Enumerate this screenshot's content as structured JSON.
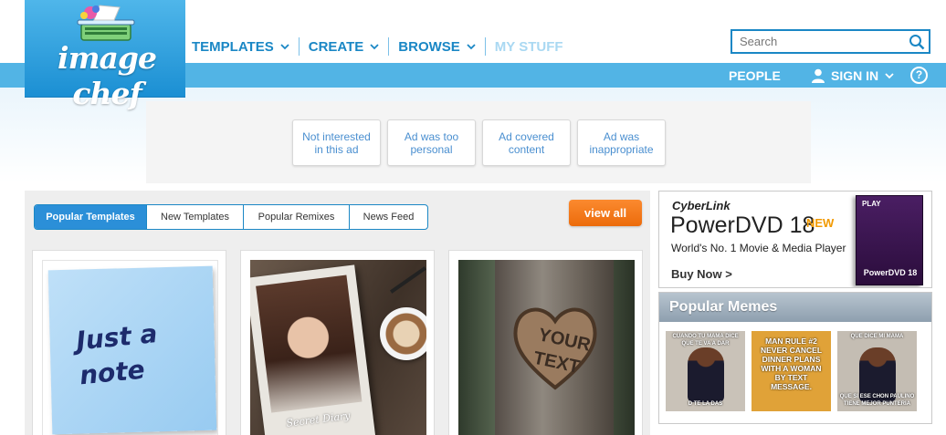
{
  "header": {
    "logo_text": "image chef",
    "nav": [
      {
        "label": "TEMPLATES",
        "has_menu": true
      },
      {
        "label": "CREATE",
        "has_menu": true
      },
      {
        "label": "BROWSE",
        "has_menu": true
      },
      {
        "label": "MY STUFF",
        "has_menu": false,
        "muted": true
      }
    ],
    "search_placeholder": "Search",
    "people_label": "PEOPLE",
    "signin_label": "SIGN IN",
    "help_label": "?"
  },
  "ad_feedback": {
    "buttons": [
      "Not interested in this ad",
      "Ad was too personal",
      "Ad covered content",
      "Ad was inappropriate"
    ]
  },
  "main": {
    "tabs": [
      {
        "label": "Popular Templates",
        "active": true
      },
      {
        "label": "New Templates",
        "active": false
      },
      {
        "label": "Popular Remixes",
        "active": false
      },
      {
        "label": "News Feed",
        "active": false
      }
    ],
    "view_all_label": "view all",
    "cards": [
      {
        "kind": "note",
        "image_text": "Just a note"
      },
      {
        "kind": "diary",
        "image_text": "Secret Diary"
      },
      {
        "kind": "tree",
        "image_text": "YOUR TEXT"
      }
    ]
  },
  "ad_rail": {
    "brand": "CyberLink",
    "product": "PowerDVD 18",
    "badge": "NEW",
    "tagline": "World's No. 1 Movie & Media Player",
    "cta": "Buy Now >",
    "box_top": "PLAY",
    "box_label": "PowerDVD 18"
  },
  "memes": {
    "title": "Popular Memes",
    "items": [
      {
        "top": "CUANDO TU MAMA DICE QUE TE VA A DAR",
        "bottom": "D TE LA DAS"
      },
      {
        "text": "MAN RULE #2 NEVER CANCEL DINNER PLANS WITH A WOMAN BY TEXT MESSAGE."
      },
      {
        "top": "QUE DICE MI MAMA",
        "bottom": "QUE SI ESE CHON PAULINO TIENE MEJOR PUNTERIA"
      }
    ]
  },
  "colors": {
    "brand_blue": "#1a87c5",
    "band_blue": "#52b4e5",
    "view_all_orange": "#f07714",
    "tab_active": "#2b8fd8"
  }
}
